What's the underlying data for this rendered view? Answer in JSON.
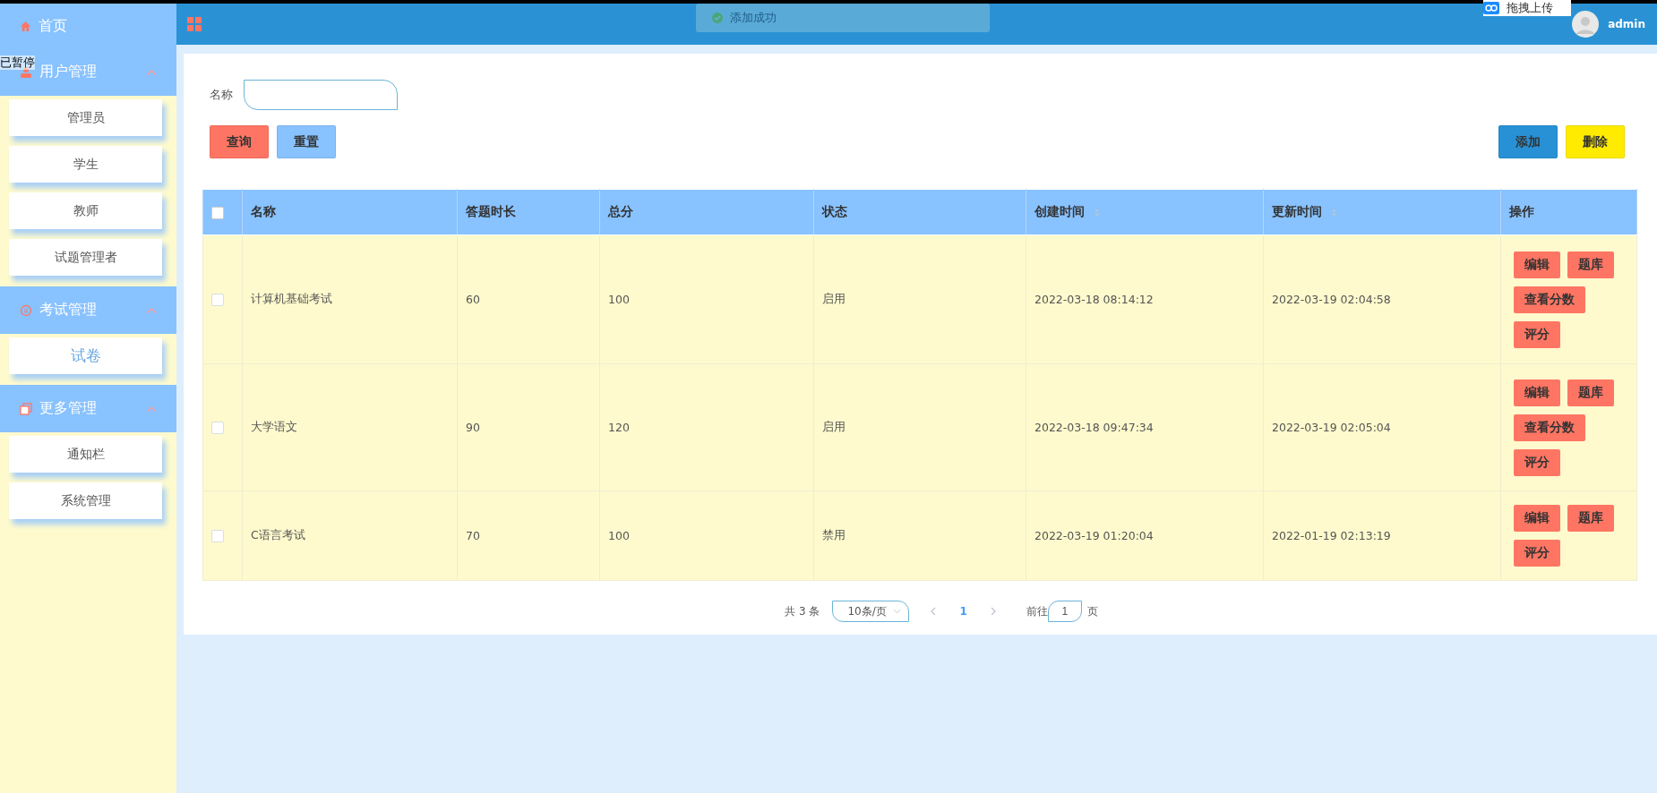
{
  "overlay_text": "已暂停",
  "topbar": {
    "toast": "添加成功",
    "upload_chip": "拖拽上传",
    "user": "admin"
  },
  "sidebar": {
    "home": {
      "label": "首页"
    },
    "groups": [
      {
        "label": "用户管理",
        "kind": "user",
        "expanded": true,
        "items": [
          {
            "label": "管理员",
            "selected": false
          },
          {
            "label": "学生",
            "selected": false
          },
          {
            "label": "教师",
            "selected": false
          },
          {
            "label": "试题管理者",
            "selected": false
          }
        ]
      },
      {
        "label": "考试管理",
        "kind": "chat",
        "expanded": true,
        "items": [
          {
            "label": "试卷",
            "selected": true
          }
        ]
      },
      {
        "label": "更多管理",
        "kind": "copy",
        "expanded": true,
        "items": [
          {
            "label": "通知栏",
            "selected": false
          },
          {
            "label": "系统管理",
            "selected": false
          }
        ]
      }
    ]
  },
  "search": {
    "label": "名称",
    "buttons": [
      {
        "label": "查询",
        "color": "#ff7563"
      },
      {
        "label": "重置",
        "color": "#88c2ff"
      }
    ],
    "actions": [
      {
        "label": "添加",
        "color": "#2891d5"
      },
      {
        "label": "删除",
        "color": "#ffeb00"
      }
    ]
  },
  "table": {
    "select_all_checked": false,
    "columns": [
      {
        "label": "名称",
        "sortable": false
      },
      {
        "label": "答题时长",
        "sortable": false
      },
      {
        "label": "总分",
        "sortable": false
      },
      {
        "label": "状态",
        "sortable": false
      },
      {
        "label": "创建时间",
        "sortable": true
      },
      {
        "label": "更新时间",
        "sortable": true
      },
      {
        "label": "操作",
        "sortable": false
      }
    ],
    "rows": [
      {
        "checked": false,
        "cells": [
          "计算机基础考试",
          "60",
          "100",
          "启用",
          "2022-03-18 08:14:12",
          "2022-03-19 02:04:58"
        ],
        "actions": [
          "编辑",
          "题库",
          "查看分数",
          "评分"
        ]
      },
      {
        "checked": false,
        "cells": [
          "大学语文",
          "90",
          "120",
          "启用",
          "2022-03-18 09:47:34",
          "2022-03-19 02:05:04"
        ],
        "actions": [
          "编辑",
          "题库",
          "查看分数",
          "评分"
        ]
      },
      {
        "checked": false,
        "cells": [
          "C语言考试",
          "70",
          "100",
          "禁用",
          "2022-03-19 01:20:04",
          "2022-01-19 02:13:19"
        ],
        "actions": [
          "编辑",
          "题库",
          "评分"
        ]
      }
    ]
  },
  "pagination": {
    "total": "共 3 条",
    "page_size": "10条/页",
    "pages": [
      {
        "label": "1",
        "selected": true
      }
    ],
    "goto_label": "前往",
    "goto_value": "1",
    "goto_suffix": "页"
  }
}
